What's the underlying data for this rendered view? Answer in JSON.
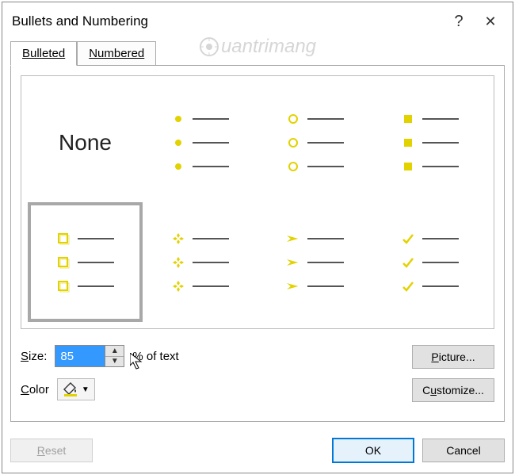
{
  "titlebar": {
    "title": "Bullets and Numbering",
    "help": "?",
    "close": "✕"
  },
  "tabs": {
    "bulleted": "Bulleted",
    "numbered": "Numbered"
  },
  "options": {
    "none_label": "None"
  },
  "controls": {
    "size_label_u": "S",
    "size_label_rest": "ize:",
    "size_value": "85",
    "percent_text": "% of text",
    "color_label_u": "C",
    "color_label_rest": "olor",
    "picture_u": "P",
    "picture_rest": "icture...",
    "customize_u": "u",
    "customize_pre": "C",
    "customize_post": "stomize..."
  },
  "footer": {
    "reset_u": "R",
    "reset_rest": "eset",
    "ok": "OK",
    "cancel": "Cancel"
  },
  "colors": {
    "bullet": "#e2d200"
  },
  "watermark": "uantrimang"
}
